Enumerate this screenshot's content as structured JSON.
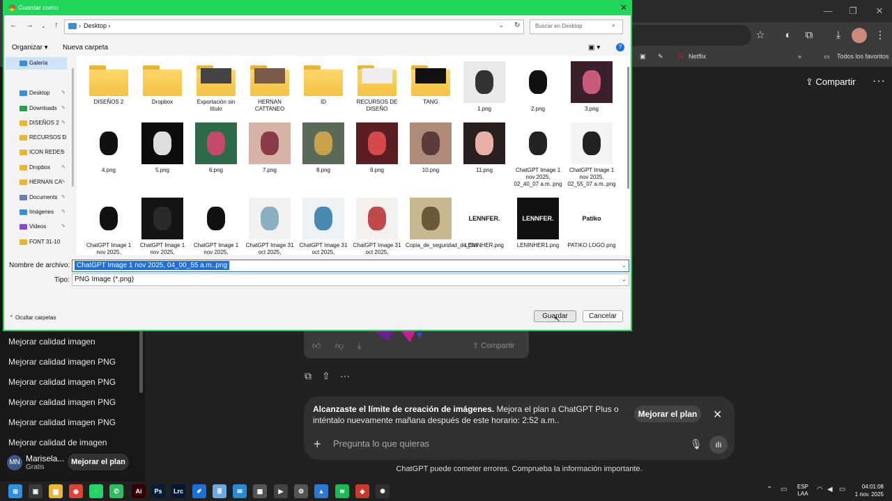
{
  "browser": {
    "bookmarks": [
      "Netflix",
      "Todos los favoritos"
    ]
  },
  "chatgpt": {
    "share_label": "Compartir",
    "card_share_label": "Compartir",
    "sidebar_items": [
      "Mejorar calidad imagen",
      "Mejorar calidad imagen PNG",
      "Mejorar calidad imagen PNG",
      "Mejorar calidad imagen PNG",
      "Mejorar calidad imagen PNG",
      "Mejorar calidad de imagen"
    ],
    "limit_banner": {
      "bold": "Alcanzaste el límite de creación de imágenes.",
      "text": " Mejora el plan a ChatGPT Plus o inténtalo nuevamente mañana después de este horario: 2:52 a.m..",
      "upgrade_label": "Mejorar el plan"
    },
    "composer_placeholder": "Pregunta lo que quieras",
    "disclaimer": "ChatGPT puede cometer errores. Comprueba la información importante.",
    "user": {
      "initials": "MN",
      "name": "Marisela...",
      "plan": "Gratis",
      "upgrade_label": "Mejorar el plan"
    }
  },
  "dialog": {
    "title": "Guardar como",
    "breadcrumb": "Desktop",
    "search_placeholder": "Buscar en Desktop",
    "organize_label": "Organizar",
    "new_folder_label": "Nueva carpeta",
    "nav_items": [
      {
        "label": "Galería",
        "color": "#3a8fd4",
        "pinned": false
      },
      {
        "label": "Desktop",
        "color": "#3a8fd4",
        "pinned": true
      },
      {
        "label": "Downloads",
        "color": "#2d9b52",
        "pinned": true
      },
      {
        "label": "DISEÑOS 2",
        "color": "#e8b534",
        "pinned": true
      },
      {
        "label": "RECURSOS D",
        "color": "#e8b534",
        "pinned": true
      },
      {
        "label": "ICON REDES",
        "color": "#e8b534",
        "pinned": true
      },
      {
        "label": "Dropbox",
        "color": "#e8b534",
        "pinned": true
      },
      {
        "label": "HERNAN CA",
        "color": "#e8b534",
        "pinned": true
      },
      {
        "label": "Documents",
        "color": "#6a7fa8",
        "pinned": true
      },
      {
        "label": "Imágenes",
        "color": "#3a8fd4",
        "pinned": true
      },
      {
        "label": "Videos",
        "color": "#8a4bc8",
        "pinned": true
      },
      {
        "label": "FONT 31-10",
        "color": "#e8b534",
        "pinned": false
      }
    ],
    "files": [
      {
        "label": "DISEÑOS 2",
        "kind": "folder"
      },
      {
        "label": "Dropbox",
        "kind": "folder"
      },
      {
        "label": "Exportación sin título",
        "kind": "folder",
        "preview": "#444"
      },
      {
        "label": "HERNAN CATTANEO",
        "kind": "folder",
        "preview": "#7a5a48"
      },
      {
        "label": "ID",
        "kind": "folder"
      },
      {
        "label": "RECURSOS DE DISEÑO",
        "kind": "folder",
        "preview": "#eee"
      },
      {
        "label": "TANG",
        "kind": "folder",
        "preview": "#111"
      },
      {
        "label": "1.png",
        "kind": "image",
        "bg": "#e9e9e9",
        "fg": "#333"
      },
      {
        "label": "2.png",
        "kind": "image",
        "bg": "#fff",
        "fg": "#111"
      },
      {
        "label": "3.png",
        "kind": "image",
        "bg": "#3b1f2c",
        "fg": "#c85a7a"
      },
      {
        "label": "4.png",
        "kind": "image",
        "bg": "#fff",
        "fg": "#111"
      },
      {
        "label": "5.png",
        "kind": "image",
        "bg": "#0c0c0c",
        "fg": "#ddd"
      },
      {
        "label": "6.png",
        "kind": "image",
        "bg": "#2e6b4a",
        "fg": "#c44a6a"
      },
      {
        "label": "7.png",
        "kind": "image",
        "bg": "#d7b2a6",
        "fg": "#8a3b4a"
      },
      {
        "label": "8.png",
        "kind": "image",
        "bg": "#5a6a58",
        "fg": "#c8a24a"
      },
      {
        "label": "9.png",
        "kind": "image",
        "bg": "#5a1e22",
        "fg": "#d44a4a"
      },
      {
        "label": "10.png",
        "kind": "image",
        "bg": "#b08a78",
        "fg": "#5a3a3a"
      },
      {
        "label": "11.png",
        "kind": "image",
        "bg": "#2a2020",
        "fg": "#e8b0a8"
      },
      {
        "label": "ChatGPT Image 1 nov 2025, 02_40_07 a.m..png",
        "kind": "image",
        "bg": "#fff",
        "fg": "#222"
      },
      {
        "label": "ChatGPT Image 1 nov 2025, 02_55_07 a.m..png",
        "kind": "image",
        "bg": "#f4f4f4",
        "fg": "#222"
      },
      {
        "label": "ChatGPT Image 1 nov 2025,",
        "kind": "image",
        "bg": "#fff",
        "fg": "#111"
      },
      {
        "label": "ChatGPT Image 1 nov 2025,",
        "kind": "image",
        "bg": "#141414",
        "fg": "#2a2a2a"
      },
      {
        "label": "ChatGPT Image 1 nov 2025,",
        "kind": "image",
        "bg": "#fff",
        "fg": "#111"
      },
      {
        "label": "ChatGPT Image 31 oct 2025,",
        "kind": "image",
        "bg": "#f2f2f2",
        "fg": "#8ab0c0"
      },
      {
        "label": "ChatGPT Image 31 oct 2025,",
        "kind": "image",
        "bg": "#eef2f4",
        "fg": "#4a8ab0"
      },
      {
        "label": "ChatGPT Image 31 oct 2025,",
        "kind": "image",
        "bg": "#f4f0ee",
        "fg": "#c04a4a"
      },
      {
        "label": "Copia_de_seguridad_de_Sin",
        "kind": "image",
        "bg": "#c8b890",
        "fg": "#6a5a3a"
      },
      {
        "label": "LENINHER.png",
        "kind": "image",
        "bg": "#fff",
        "fg": "#111",
        "text": "LENNFER."
      },
      {
        "label": "LENINHER1.png",
        "kind": "image",
        "bg": "#111",
        "fg": "#fff",
        "text": "LENNFER."
      },
      {
        "label": "PATIKO LOGO.png",
        "kind": "image",
        "bg": "#fff",
        "fg": "#111",
        "text": "Patiko"
      }
    ],
    "filename_label": "Nombre de archivo:",
    "filename_value": "ChatGPT Image 1 nov 2025, 04_00_55 a.m..png",
    "type_label": "Tipo:",
    "type_value": "PNG Image (*.png)",
    "hide_folders_label": "Ocultar carpetas",
    "save_label": "Guardar",
    "cancel_label": "Cancelar"
  },
  "taskbar": {
    "lang": "ESP",
    "lang_sub": "LAA",
    "time": "04:01:08",
    "date": "1 nov. 2025",
    "apps": [
      {
        "name": "windows-start",
        "color": "#2f8fe0",
        "glyph": "⊞"
      },
      {
        "name": "task-view",
        "color": "#3a3a3a",
        "glyph": "▣"
      },
      {
        "name": "file-explorer",
        "color": "#e8b534",
        "glyph": "▆"
      },
      {
        "name": "chrome",
        "color": "#db4437",
        "glyph": "◉"
      },
      {
        "name": "whatsapp",
        "color": "#25d366",
        "glyph": "◌"
      },
      {
        "name": "phone-app",
        "color": "#2dbe60",
        "glyph": "✆"
      },
      {
        "name": "illustrator",
        "color": "#330000",
        "glyph": "Ai"
      },
      {
        "name": "photoshop",
        "color": "#001e36",
        "glyph": "Ps"
      },
      {
        "name": "lightroom",
        "color": "#001a33",
        "glyph": "Lrc"
      },
      {
        "name": "draw-app",
        "color": "#1e6fd9",
        "glyph": "✐"
      },
      {
        "name": "notepad",
        "color": "#6aa8e0",
        "glyph": "≣"
      },
      {
        "name": "mail-app",
        "color": "#2a8ad4",
        "glyph": "✉"
      },
      {
        "name": "calculator",
        "color": "#555",
        "glyph": "▦"
      },
      {
        "name": "media-player",
        "color": "#444",
        "glyph": "▶"
      },
      {
        "name": "settings",
        "color": "#555",
        "glyph": "⚙"
      },
      {
        "name": "photos",
        "color": "#2a7ad4",
        "glyph": "▲"
      },
      {
        "name": "spotify",
        "color": "#1db954",
        "glyph": "≋"
      },
      {
        "name": "game-app",
        "color": "#c83a2a",
        "glyph": "◆"
      },
      {
        "name": "chatgpt-app",
        "color": "#303030",
        "glyph": "✺"
      }
    ]
  }
}
